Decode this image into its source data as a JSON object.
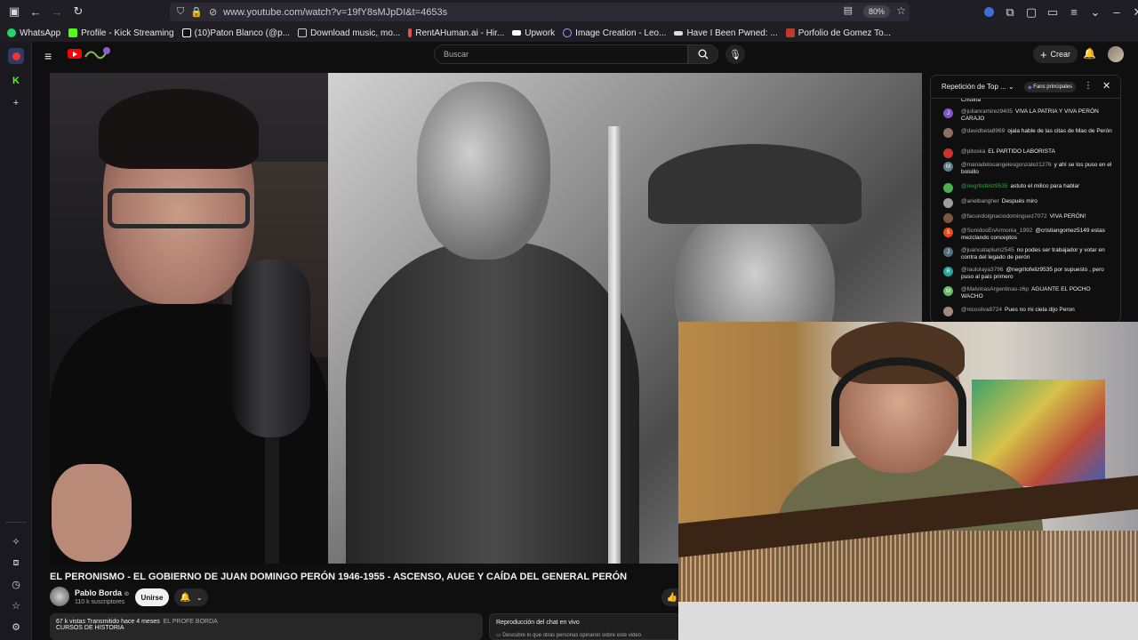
{
  "browser": {
    "url": "www.youtube.com/watch?v=19fY8sMJpDI&t=4653s",
    "zoom": "80%"
  },
  "bookmarks": [
    {
      "label": "WhatsApp",
      "color": "#25d366"
    },
    {
      "label": "Profile - Kick Streaming",
      "color": "#53fc18"
    },
    {
      "label": "(10)Paton Blanco (@p...",
      "color": "#ffffff"
    },
    {
      "label": "Download music, mo...",
      "color": "#cccccc"
    },
    {
      "label": "RentAHuman.ai - Hir...",
      "color": "#e0524a"
    },
    {
      "label": "Upwork",
      "color": "#ffffff"
    },
    {
      "label": "Image Creation - Leo...",
      "color": "#9aa0ff"
    },
    {
      "label": "Have I Been Pwned: ...",
      "color": "#dddddd"
    },
    {
      "label": "Porfolio de Gomez To...",
      "color": "#c0392b"
    }
  ],
  "youtube": {
    "search_placeholder": "Buscar",
    "create_label": "Crear"
  },
  "video": {
    "title": "EL PERONISMO - EL GOBIERNO DE JUAN DOMINGO PERÓN 1946-1955 - ASCENSO, AUGE Y CAÍDA DEL GENERAL PERÓN",
    "channel": "Pablo Borda",
    "verified": "⊙",
    "subscribers": "110 k suscriptores",
    "join_label": "Unirse",
    "views_line": "67 k vistas  Transmitido hace 4 meses",
    "tag": "EL PROFE BORDA",
    "category": "CURSOS DE HISTORIA",
    "chat_replay_title": "Reproducción del chat en vivo",
    "chat_replay_sub": "Descubre lo que otras personas opinaron sobre este video"
  },
  "chat": {
    "title": "Repetición de Top ...",
    "fans_badge": "Fans principales",
    "top_fragment": "Cristina",
    "messages": [
      {
        "initial": "J",
        "color": "#7e57c2",
        "user": "@julianramirez9405",
        "text": "VIVA LA PATRIA Y VIVA PERÓN CARAJO"
      },
      {
        "initial": "",
        "color": "#8d6e63",
        "user": "@davidbeta8969",
        "text": "ojala hable de las citas de Mao de Perón"
      },
      {
        "initial": "",
        "color": "#d32f2f",
        "user": "@pitoska",
        "text": "EL PARTIDO LABORISTA"
      },
      {
        "initial": "M",
        "color": "#607d8b",
        "user": "@mariadelosangelesgonzalez1276",
        "text": "y ahí se los puso en el bolsillo"
      },
      {
        "initial": "",
        "color": "#4caf50",
        "user": "@negritofeliz9535",
        "text": "astuto el milico para hablar",
        "green": true
      },
      {
        "initial": "",
        "color": "#9e9e9e",
        "user": "@arielbangher",
        "text": "Después miro"
      },
      {
        "initial": "",
        "color": "#795548",
        "user": "@facundoignaciodominguez7072",
        "text": "VIVA PERÓN!"
      },
      {
        "initial": "S",
        "color": "#e64a19",
        "user": "@SonidosEnArmonia_1992",
        "text": "@cristiangomez5149 estas mezclando conceptos"
      },
      {
        "initial": "J",
        "color": "#546e7a",
        "user": "@juancataplum2545",
        "text": "no podes ser trabajador y votar en contra del legado de perón"
      },
      {
        "initial": "R",
        "color": "#26a69a",
        "user": "@raulolaya3796",
        "text": "@negritofeliz9535 por supuesto , pero puso al pais primero"
      },
      {
        "initial": "M",
        "color": "#66bb6a",
        "user": "@MalvinasArgentinas-z6p",
        "text": "AGUANTE EL POCHO WACHO"
      },
      {
        "initial": "",
        "color": "#a1887f",
        "user": "@nicosilva8724",
        "text": "Pues no mi ciela dijo Peron"
      }
    ]
  }
}
